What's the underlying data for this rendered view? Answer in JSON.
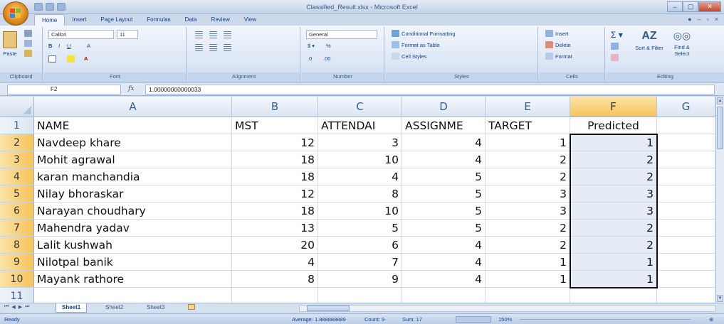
{
  "window": {
    "title": "Classified_Result.xlsx - Microsoft Excel",
    "controls": [
      "–",
      "▢",
      "✕"
    ]
  },
  "ribbon_tabs": [
    "Home",
    "Insert",
    "Page Layout",
    "Formulas",
    "Data",
    "Review",
    "View"
  ],
  "ribbon": {
    "clipboard": {
      "label": "Clipboard",
      "paste": "Paste"
    },
    "font": {
      "label": "Font",
      "name": "Calibri",
      "size": "11"
    },
    "alignment": {
      "label": "Alignment"
    },
    "number": {
      "label": "Number",
      "format": "General"
    },
    "styles": {
      "label": "Styles",
      "conditional": "Conditional Formatting",
      "format_table": "Format as Table",
      "cell_styles": "Cell Styles"
    },
    "cells": {
      "label": "Cells",
      "insert": "Insert",
      "delete": "Delete",
      "format": "Format"
    },
    "editing": {
      "label": "Editing",
      "sort": "Sort & Filter",
      "find": "Find & Select"
    }
  },
  "formula_bar": {
    "name_box": "F2",
    "fx": "fx",
    "value": "1.00000000000033"
  },
  "columns": [
    "A",
    "B",
    "C",
    "D",
    "E",
    "F",
    "G"
  ],
  "selected_column": "F",
  "rows": [
    {
      "num": "1",
      "cells": [
        "NAME",
        "MST",
        "ATTENDAI",
        "ASSIGNME",
        "TARGET",
        "Predicted"
      ]
    },
    {
      "num": "2",
      "cells": [
        "Navdeep khare",
        "12",
        "3",
        "4",
        "1",
        "1"
      ]
    },
    {
      "num": "3",
      "cells": [
        "Mohit agrawal",
        "18",
        "10",
        "4",
        "2",
        "2"
      ]
    },
    {
      "num": "4",
      "cells": [
        "karan manchandia",
        "18",
        "4",
        "5",
        "2",
        "2"
      ]
    },
    {
      "num": "5",
      "cells": [
        "Nilay bhoraskar",
        "12",
        "8",
        "5",
        "3",
        "3"
      ]
    },
    {
      "num": "6",
      "cells": [
        "Narayan choudhary",
        "18",
        "10",
        "5",
        "3",
        "3"
      ]
    },
    {
      "num": "7",
      "cells": [
        "Mahendra yadav",
        "13",
        "5",
        "5",
        "2",
        "2"
      ]
    },
    {
      "num": "8",
      "cells": [
        "Lalit kushwah",
        "20",
        "6",
        "4",
        "2",
        "2"
      ]
    },
    {
      "num": "9",
      "cells": [
        "Nilotpal banik",
        "4",
        "7",
        "4",
        "1",
        "1"
      ]
    },
    {
      "num": "10",
      "cells": [
        "Mayank rathore",
        "8",
        "9",
        "4",
        "1",
        "1"
      ]
    },
    {
      "num": "11",
      "cells": [
        "",
        "",
        "",
        "",
        "",
        ""
      ]
    }
  ],
  "sheets": [
    "Sheet1",
    "Sheet2",
    "Sheet3"
  ],
  "active_sheet": "Sheet1",
  "status": {
    "ready": "Ready",
    "average": "Average: 1.888888889",
    "count": "Count: 9",
    "sum": "Sum: 17",
    "zoom": "150%"
  },
  "colors": {
    "accent": "#15428b",
    "selection": "#f6c35a",
    "ribbon": "#dbe6f5"
  }
}
